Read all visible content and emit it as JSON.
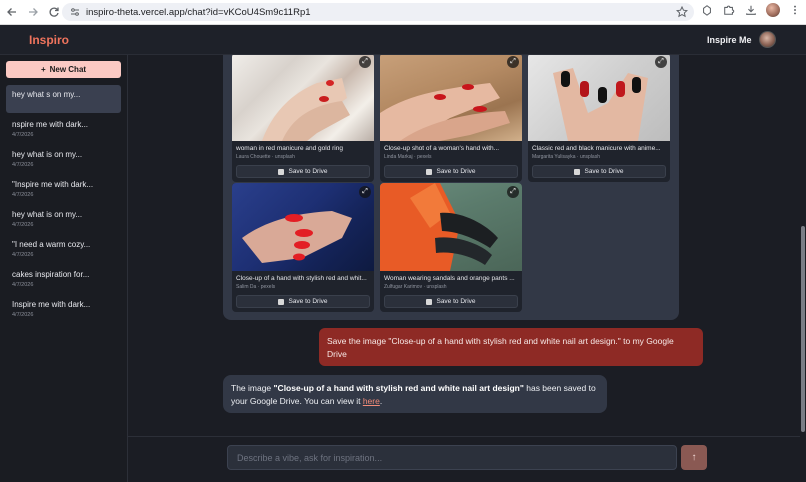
{
  "browser": {
    "url": "inspiro-theta.vercel.app/chat?id=vKCoU4Sm9c11Rp1",
    "icons": [
      "back-icon",
      "forward-icon",
      "reload-icon",
      "site-settings-icon",
      "bookmark-star-icon",
      "extension-icon",
      "puzzle-icon",
      "download-icon",
      "profile-avatar",
      "menu-icon"
    ]
  },
  "header": {
    "brand": "Inspiro",
    "inspire_me": "Inspire Me",
    "brand_color": "#f0745d"
  },
  "sidebar": {
    "new_chat": "New Chat",
    "chats": [
      {
        "title": "hey what s on my...",
        "date": ""
      },
      {
        "title": "nspire me with dark...",
        "date": "4/7/2026"
      },
      {
        "title": "hey what is on my...",
        "date": "4/7/2026"
      },
      {
        "title": "\"Inspire me with dark...",
        "date": "4/7/2026"
      },
      {
        "title": "hey what is on my...",
        "date": "4/7/2026"
      },
      {
        "title": "\"I need a warm cozy...",
        "date": "4/7/2026"
      },
      {
        "title": "cakes inspiration for...",
        "date": "4/7/2026"
      },
      {
        "title": "Inspire me with dark...",
        "date": "4/7/2026"
      }
    ]
  },
  "gallery": {
    "save_label": "Save to Drive",
    "cards": [
      {
        "caption": "woman in red manicure and gold ring",
        "credit": "Laura Chouette · unsplash"
      },
      {
        "caption": "Close-up shot of a woman's hand with...",
        "credit": "Linda Markaj · pexels"
      },
      {
        "caption": "Classic red and black manicure with anime...",
        "credit": "Margarita Yulisayka · unsplash"
      },
      {
        "caption": "Close-up of a hand with stylish red and whit...",
        "credit": "Salim Da · pexels"
      },
      {
        "caption": "Woman wearing sandals and orange pants ...",
        "credit": "Zulfugar Karimov · unsplash"
      }
    ]
  },
  "messages": {
    "user": "Save the image \"Close-up of a hand with stylish red and white nail art design.\" to my Google Drive",
    "bot_prefix": "The image ",
    "bot_bold": "\"Close-up of a hand with stylish red and white nail art design\"",
    "bot_middle": " has been saved to your Google Drive. You can view it ",
    "bot_link": "here",
    "bot_suffix": "."
  },
  "composer": {
    "placeholder": "Describe a vibe, ask for inspiration...",
    "value": ""
  }
}
